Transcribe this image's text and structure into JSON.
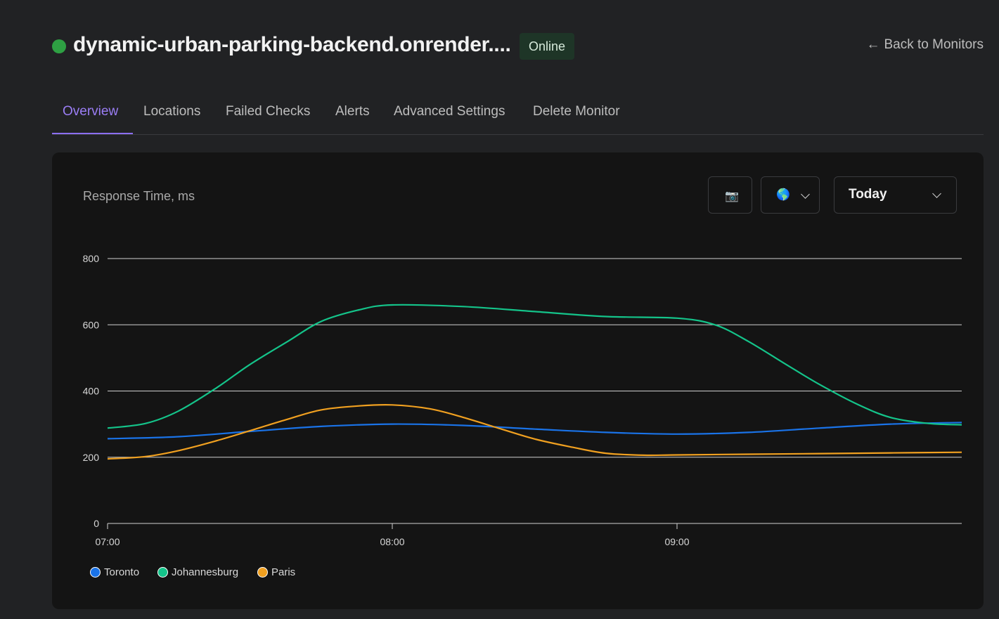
{
  "header": {
    "title": "dynamic-urban-parking-backend.onrender....",
    "status": "Online",
    "back_arrow": "←",
    "back_label": "Back to Monitors"
  },
  "tabs": [
    {
      "label": "Overview",
      "active": true
    },
    {
      "label": "Locations"
    },
    {
      "label": "Failed Checks"
    },
    {
      "label": "Alerts"
    },
    {
      "label": "Advanced Settings"
    },
    {
      "label": "Delete Monitor"
    }
  ],
  "card": {
    "title": "Response Time, ms",
    "camera_icon": "📷",
    "globe_icon": "🌎",
    "range_label": "Today"
  },
  "colors": {
    "accent": "#8b6ef0",
    "online": "#2ea043",
    "toronto": "#1a73e8",
    "johannesburg": "#14c48a",
    "paris": "#f0a020"
  },
  "chart_data": {
    "type": "line",
    "title": "Response Time, ms",
    "xlabel": "",
    "ylabel": "",
    "ylim": [
      0,
      800
    ],
    "yticks": [
      0,
      200,
      400,
      600,
      800
    ],
    "xticks": [
      {
        "label": "07:00",
        "value": 0
      },
      {
        "label": "08:00",
        "value": 60
      },
      {
        "label": "09:00",
        "value": 120
      }
    ],
    "xlim": [
      0,
      180
    ],
    "grid": true,
    "legend_position": "bottom-left",
    "series": [
      {
        "name": "Toronto",
        "color": "#1a73e8",
        "x": [
          0,
          15,
          30,
          45,
          60,
          75,
          90,
          105,
          120,
          135,
          150,
          165,
          180
        ],
        "y": [
          256,
          262,
          278,
          293,
          300,
          296,
          285,
          275,
          270,
          275,
          288,
          300,
          305
        ]
      },
      {
        "name": "Johannesburg",
        "color": "#14c48a",
        "x": [
          0,
          8,
          15,
          23,
          30,
          38,
          45,
          53,
          60,
          75,
          90,
          105,
          120,
          128,
          135,
          143,
          150,
          158,
          165,
          173,
          180
        ],
        "y": [
          288,
          302,
          340,
          410,
          480,
          550,
          610,
          645,
          660,
          655,
          640,
          625,
          620,
          600,
          550,
          480,
          420,
          360,
          320,
          302,
          298
        ]
      },
      {
        "name": "Paris",
        "color": "#f0a020",
        "x": [
          0,
          8,
          15,
          23,
          30,
          38,
          45,
          53,
          60,
          68,
          75,
          83,
          90,
          98,
          105,
          113,
          120,
          135,
          150,
          165,
          180
        ],
        "y": [
          195,
          202,
          220,
          250,
          280,
          315,
          343,
          355,
          358,
          346,
          320,
          285,
          255,
          230,
          212,
          206,
          207,
          209,
          211,
          213,
          215
        ]
      }
    ]
  }
}
